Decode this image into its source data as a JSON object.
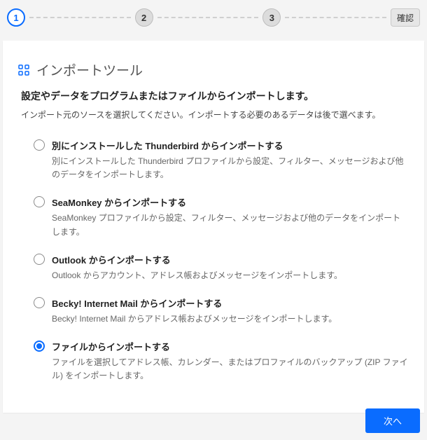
{
  "stepper": {
    "steps": [
      "1",
      "2",
      "3"
    ],
    "confirm_label": "確認",
    "active_index": 0
  },
  "page": {
    "title": "インポートツール",
    "subtitle": "設定やデータをプログラムまたはファイルからインポートします。",
    "description": "インポート元のソースを選択してください。インポートする必要のあるデータは後で選べます。"
  },
  "options": [
    {
      "label": "別にインストールした Thunderbird からインポートする",
      "desc": "別にインストールした Thunderbird プロファイルから設定、フィルター、メッセージおよび他のデータをインポートします。",
      "selected": false
    },
    {
      "label": "SeaMonkey からインポートする",
      "desc": "SeaMonkey プロファイルから設定、フィルター、メッセージおよび他のデータをインポートします。",
      "selected": false
    },
    {
      "label": "Outlook からインポートする",
      "desc": "Outlook からアカウント、アドレス帳およびメッセージをインポートします。",
      "selected": false
    },
    {
      "label": "Becky! Internet Mail からインポートする",
      "desc": "Becky! Internet Mail からアドレス帳およびメッセージをインポートします。",
      "selected": false
    },
    {
      "label": "ファイルからインポートする",
      "desc": "ファイルを選択してアドレス帳、カレンダー、またはプロファイルのバックアップ (ZIP ファイル) をインポートします。",
      "selected": true
    }
  ],
  "footer": {
    "next_label": "次へ"
  },
  "colors": {
    "accent": "#0a6cff"
  }
}
